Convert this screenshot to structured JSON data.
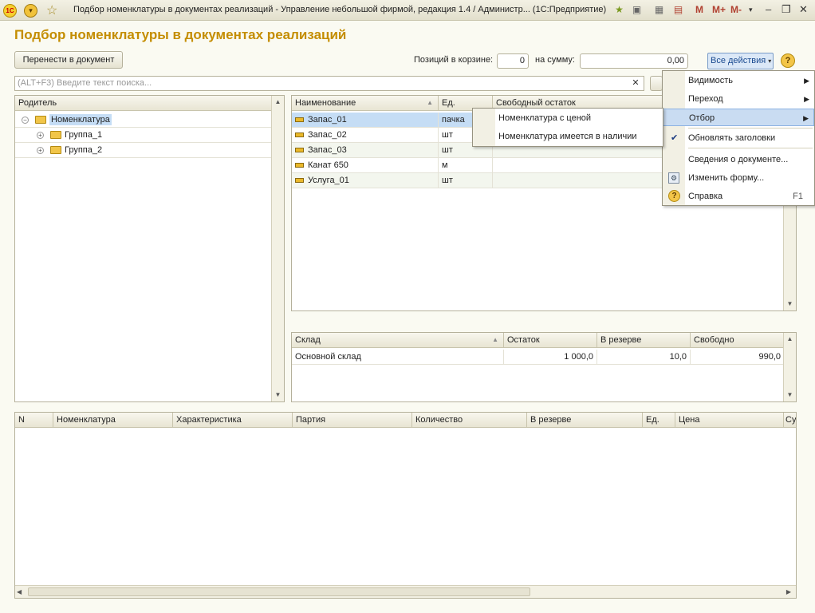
{
  "window": {
    "title": "Подбор номенклатуры в документах реализаций - Управление небольшой фирмой, редакция 1.4 / Администр...  (1С:Предприятие)",
    "logo": "1С",
    "toolbar_m": [
      "M",
      "M+",
      "M-"
    ]
  },
  "page": {
    "title": "Подбор номенклатуры в документах реализаций"
  },
  "toolbar": {
    "transfer_label": "Перенести в документ",
    "cart_positions_label": "Позиций в корзине:",
    "cart_positions_value": "0",
    "sum_label": "на сумму:",
    "sum_value": "0,00",
    "all_actions_label": "Все действия",
    "help_label": "?"
  },
  "search": {
    "placeholder": "(ALT+F3) Введите текст поиска..."
  },
  "tree": {
    "header": "Родитель",
    "items": [
      {
        "label": "Номенклатура",
        "level": 0,
        "expanded": true,
        "selected": true
      },
      {
        "label": "Группа_1",
        "level": 1
      },
      {
        "label": "Группа_2",
        "level": 1
      }
    ]
  },
  "items_table": {
    "columns": [
      "Наименование",
      "Ед.",
      "Свободный остаток"
    ],
    "rows": [
      {
        "name": "Запас_01",
        "unit": "пачка",
        "selected": true
      },
      {
        "name": "Запас_02",
        "unit": "шт"
      },
      {
        "name": "Запас_03",
        "unit": "шт"
      },
      {
        "name": "Канат 650",
        "unit": "м"
      },
      {
        "name": "Услуга_01",
        "unit": "шт"
      }
    ]
  },
  "stock_table": {
    "columns": [
      "Склад",
      "Остаток",
      "В резерве",
      "Свободно"
    ],
    "rows": [
      {
        "warehouse": "Основной склад",
        "balance": "1 000,0",
        "reserved": "10,0",
        "free": "990,0"
      }
    ]
  },
  "cart_table": {
    "columns": [
      "N",
      "Номенклатура",
      "Характеристика",
      "Партия",
      "Количество",
      "В резерве",
      "Ед.",
      "Цена",
      "Су"
    ]
  },
  "actions_menu": {
    "items": [
      {
        "label": "Видимость",
        "submenu": true
      },
      {
        "label": "Переход",
        "submenu": true
      },
      {
        "label": "Отбор",
        "submenu": true,
        "highlighted": true
      },
      {
        "label": "Обновлять заголовки",
        "checked": true
      },
      {
        "label": "Сведения о документе..."
      },
      {
        "label": "Изменить форму..."
      },
      {
        "label": "Справка",
        "shortcut": "F1"
      }
    ]
  },
  "filter_submenu": {
    "items": [
      {
        "label": "Номенклатура с ценой"
      },
      {
        "label": "Номенклатура имеется в наличии"
      }
    ]
  },
  "colors": {
    "accent": "#c48d00",
    "selection": "#c5ddf5",
    "menu_highlight": "#c9dcf2"
  }
}
